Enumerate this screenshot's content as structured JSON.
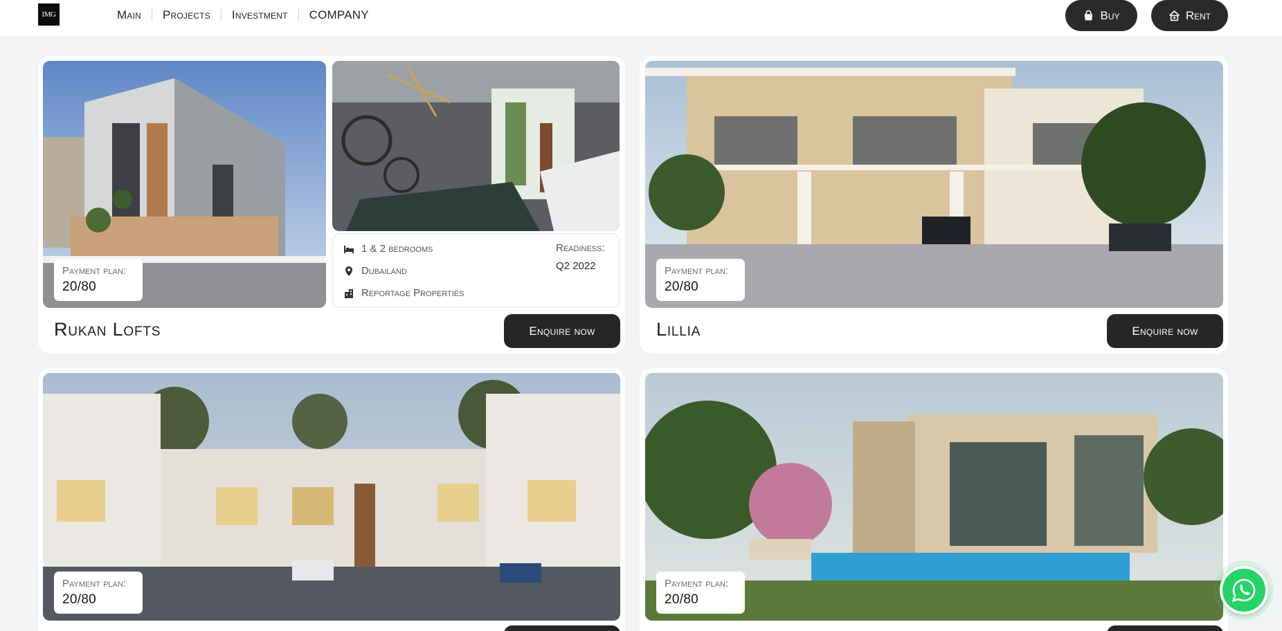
{
  "header": {
    "logo": "IMG",
    "nav": [
      "Main",
      "Projects",
      "Investment",
      "COMPANY"
    ],
    "buy_label": "Buy",
    "rent_label": "Rent"
  },
  "cards": [
    {
      "title": "Rukan Lofts",
      "payment_plan_label": "Payment plan:",
      "payment_plan_value": "20/80",
      "bedrooms": "1 & 2 bedrooms",
      "location": "Dubailand",
      "developer": "Reportage Properties",
      "readiness_label": "Readiness:",
      "readiness_value": "Q2 2022",
      "enquire_label": "Enquire now"
    },
    {
      "title": "Lillia",
      "payment_plan_label": "Payment plan:",
      "payment_plan_value": "20/80",
      "enquire_label": "Enquire now"
    },
    {
      "payment_plan_label": "Payment plan:",
      "payment_plan_value": "20/80"
    },
    {
      "payment_plan_label": "Payment plan:",
      "payment_plan_value": "20/80"
    }
  ],
  "icons": {
    "buy": "shopping-bag-icon",
    "rent": "house-key-icon",
    "bed": "bed-icon",
    "location": "location-pin-icon",
    "developer": "building-icon",
    "whatsapp": "whatsapp-icon"
  },
  "colors": {
    "dark_button": "#262626",
    "page_bg": "#f2f3f5",
    "whatsapp": "#25d366"
  }
}
